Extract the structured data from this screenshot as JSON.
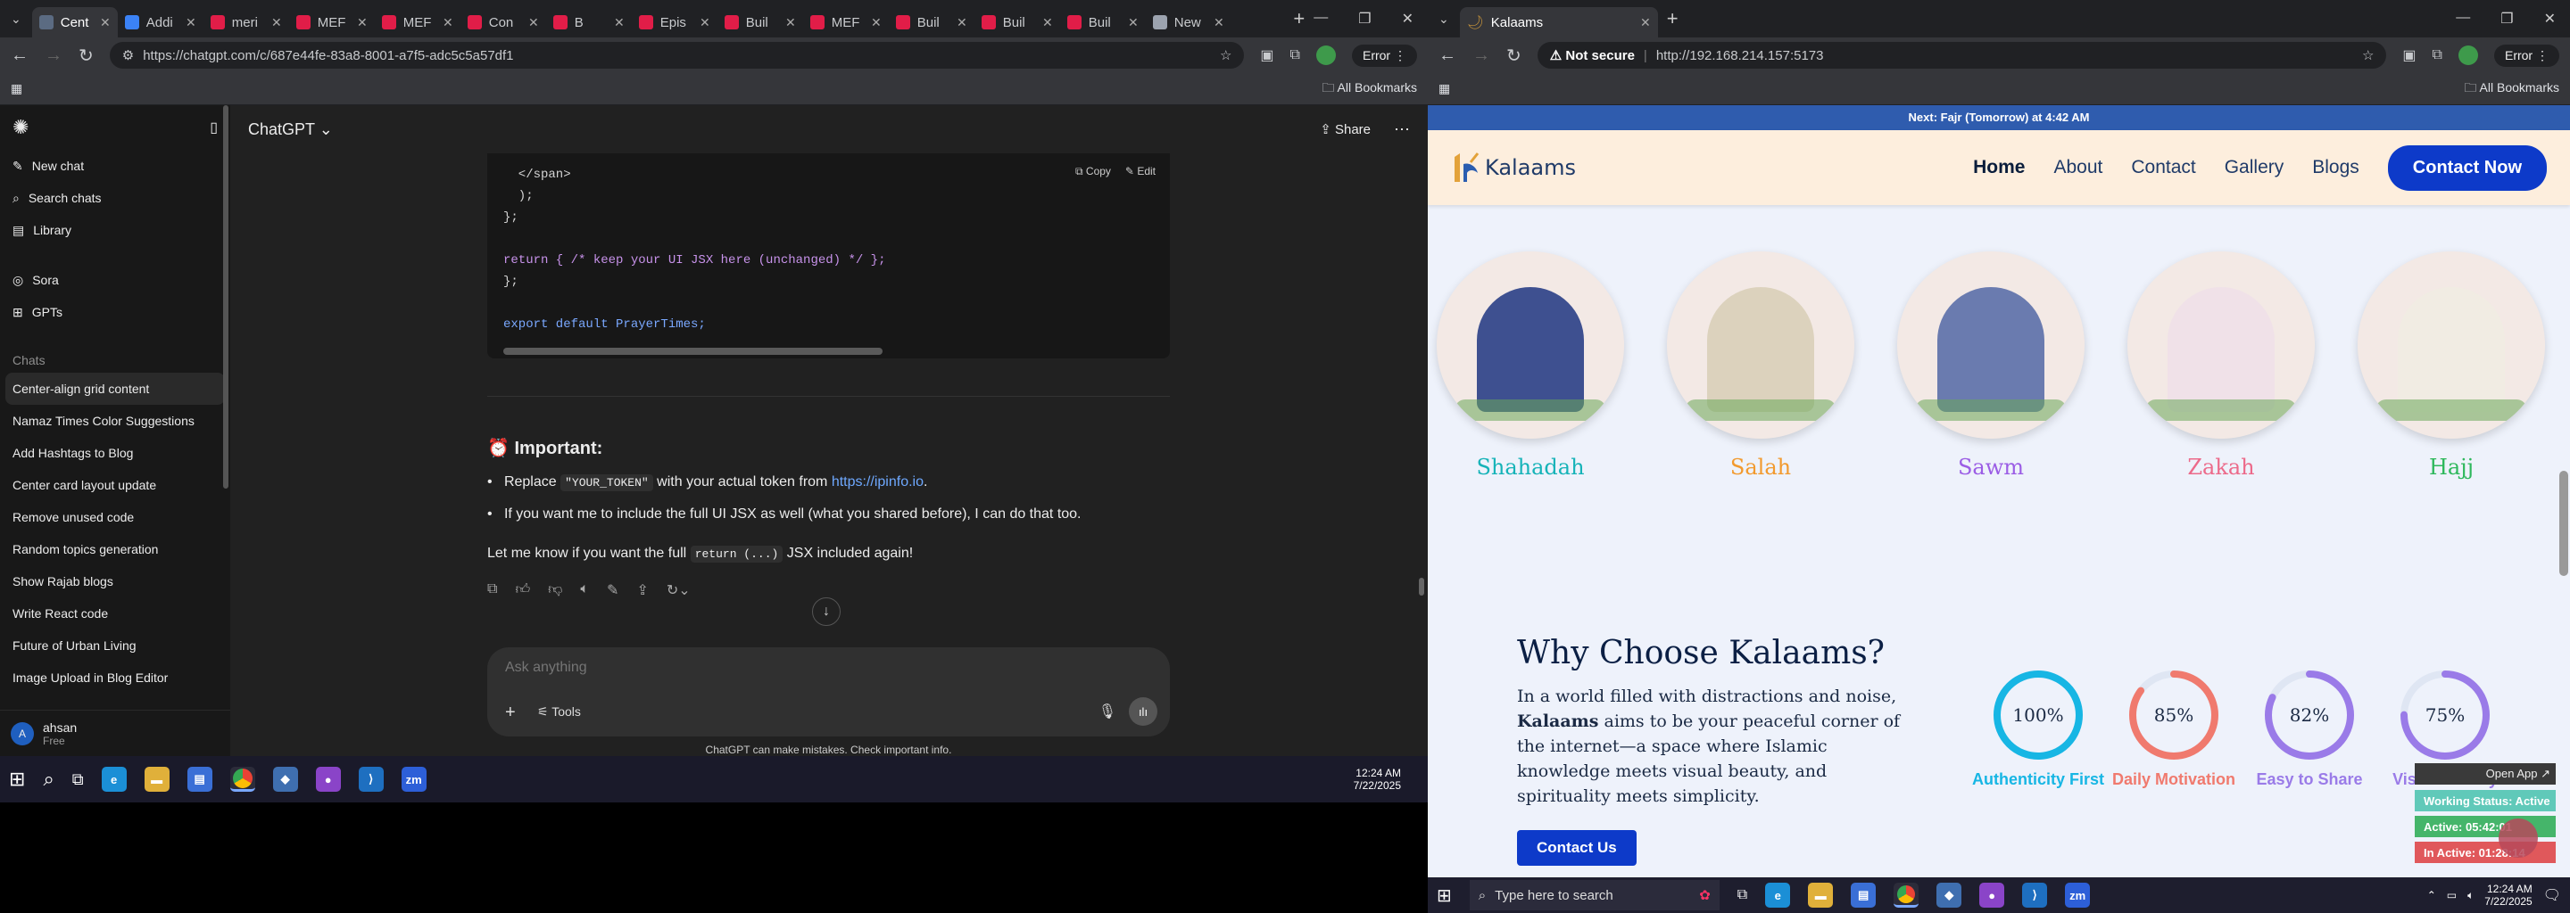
{
  "left_window": {
    "tabs": [
      {
        "label": "Cent",
        "color": "#5b6b82"
      },
      {
        "label": "Addi",
        "color": "#3b82f6"
      },
      {
        "label": "meri",
        "color": "#e11d48"
      },
      {
        "label": "MEF",
        "color": "#e11d48"
      },
      {
        "label": "MEF",
        "color": "#e11d48"
      },
      {
        "label": "Con",
        "color": "#e11d48"
      },
      {
        "label": "B",
        "color": "#e11d48"
      },
      {
        "label": "Epis",
        "color": "#e11d48"
      },
      {
        "label": "Buil",
        "color": "#e11d48"
      },
      {
        "label": "MEF",
        "color": "#e11d48"
      },
      {
        "label": "Buil",
        "color": "#e11d48"
      },
      {
        "label": "Buil",
        "color": "#e11d48"
      },
      {
        "label": "Buil",
        "color": "#e11d48"
      },
      {
        "label": "New",
        "color": "#9ca3af"
      }
    ],
    "url": "https://chatgpt.com/c/687e44fe-83a8-8001-a7f5-adc5c5a57df1",
    "error_label": "Error",
    "all_bookmarks": "All Bookmarks",
    "app_title": "ChatGPT",
    "share_label": "Share",
    "sidebar": {
      "top_items": [
        "New chat",
        "Search chats",
        "Library"
      ],
      "tools": [
        "Sora",
        "GPTs"
      ],
      "chats_heading": "Chats",
      "chats": [
        "Center-align grid content",
        "Namaz Times Color Suggestions",
        "Add Hashtags to Blog",
        "Center card layout update",
        "Remove unused code",
        "Random topics generation",
        "Show Rajab blogs",
        "Write React code",
        "Future of Urban Living",
        "Image Upload in Blog Editor"
      ],
      "user_name": "ahsan",
      "user_plan": "Free",
      "avatar_letter": "A"
    },
    "code": {
      "copy_label": "Copy",
      "edit_label": "Edit",
      "lines": [
        "  </span>",
        "  );",
        "};",
        "",
        "return { /* keep your UI JSX here (unchanged) */ };",
        "};",
        "",
        "export default PrayerTimes;"
      ]
    },
    "message": {
      "heading": "Important:",
      "bullet1_pre": "Replace",
      "bullet1_code": "\"YOUR_TOKEN\"",
      "bullet1_mid": "with your actual token from",
      "bullet1_link": "https://ipinfo.io",
      "bullet1_end": ".",
      "bullet2": "If you want me to include the full UI JSX as well (what you shared before), I can do that too.",
      "closing_pre": "Let me know if you want the full",
      "closing_code": "return (...)",
      "closing_end": "JSX included again!"
    },
    "composer": {
      "placeholder": "Ask anything",
      "tools_label": "Tools"
    },
    "disclaimer": "ChatGPT can make mistakes. Check important info.",
    "taskbar": {
      "time": "12:24 AM",
      "date": "7/22/2025"
    }
  },
  "right_window": {
    "tab_title": "Kalaams",
    "not_secure": "Not secure",
    "url": "http://192.168.214.157:5173",
    "error_label": "Error",
    "all_bookmarks": "All Bookmarks",
    "banner": "Next: Fajr (Tomorrow) at 4:42 AM",
    "logo": "Kalaams",
    "nav": [
      "Home",
      "About",
      "Contact",
      "Gallery",
      "Blogs"
    ],
    "contact_now": "Contact Now",
    "pillars": [
      {
        "name": "Shahadah",
        "color": "#16b3b8"
      },
      {
        "name": "Salah",
        "color": "#f29a2e"
      },
      {
        "name": "Sawm",
        "color": "#9b5de5"
      },
      {
        "name": "Zakah",
        "color": "#ec6a8a"
      },
      {
        "name": "Hajj",
        "color": "#2eb85c"
      }
    ],
    "why": {
      "title": "Why Choose Kalaams?",
      "p1": "In a world filled with distractions and noise,",
      "brand": "Kalaams",
      "p2": "aims to be your peaceful corner of the internet—a space where Islamic knowledge meets visual beauty, and spirituality meets simplicity.",
      "button": "Contact Us"
    },
    "stats": [
      {
        "value": "100%",
        "label": "Authenticity First",
        "color": "#17b6e4",
        "fraction": 1.0
      },
      {
        "value": "85%",
        "label": "Daily Motivation",
        "color": "#f07a6e",
        "fraction": 0.85
      },
      {
        "value": "82%",
        "label": "Easy to Share",
        "color": "#9a7be8",
        "fraction": 0.82
      },
      {
        "value": "75%",
        "label": "Visual Beauty",
        "color": "#9a7be8",
        "fraction": 0.75
      }
    ],
    "overlay": {
      "open_app": "Open App ↗",
      "working": "Working Status: Active",
      "active": "Active: 05:42:01",
      "inactive": "In Active: 01:28:14"
    },
    "taskbar": {
      "search": "Type here to search",
      "time": "12:24 AM",
      "date": "7/22/2025",
      "zm": "zm"
    }
  }
}
